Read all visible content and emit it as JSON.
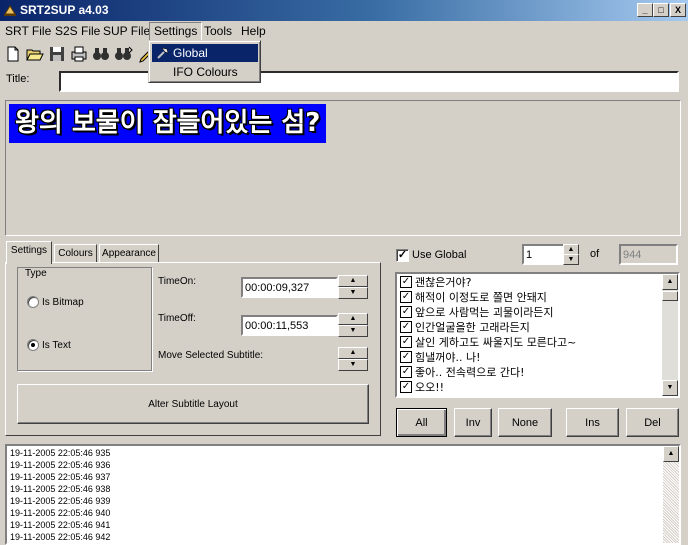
{
  "window": {
    "title": "SRT2SUP a4.03",
    "controls": [
      "_",
      "□",
      "X"
    ]
  },
  "menu": {
    "items": [
      "SRT File",
      "S2S File",
      "SUP File",
      "Settings",
      "Tools",
      "Help"
    ],
    "settings_dropdown": [
      "Global",
      "IFO Colours"
    ]
  },
  "toolbar": {
    "icons": [
      "new-file-icon",
      "open-folder-icon",
      "save-disk-icon",
      "print-icon",
      "find-binoculars-icon",
      "find-next-binoculars-icon",
      "pencil-icon"
    ]
  },
  "title_field": {
    "label": "Title:",
    "value": ""
  },
  "preview": {
    "text": "왕의 보물이 잠들어있는 섬?",
    "bg_color": "#0000ff"
  },
  "tabs": [
    "Settings",
    "Colours",
    "Appearance"
  ],
  "settings_panel": {
    "type_group_label": "Type",
    "radio_bitmap": "Is Bitmap",
    "radio_text": "Is Text",
    "selected_type": "Is Text",
    "time_on_label": "TimeOn:",
    "time_on_value": "00:00:09,327",
    "time_off_label": "TimeOff:",
    "time_off_value": "00:00:11,553",
    "move_label": "Move Selected Subtitle:",
    "alter_button": "Alter Subtitle Layout"
  },
  "right_panel": {
    "use_global_label": "Use Global",
    "use_global_checked": true,
    "current_index": "1",
    "of_label": "of",
    "total": "944",
    "subtitles": [
      "괜찮은거야?",
      "해적이 이정도로 쫄면 안돼지",
      "앞으로 사람먹는 괴물이라든지",
      "인간얼굴을한 고래라든지",
      "살인 게하고도 싸울지도 모른다고~",
      "힘낼꺼야.. 나!",
      "좋아.. 전속력으로 간다!",
      "오오!!"
    ],
    "buttons": [
      "All",
      "Inv",
      "None",
      "Ins",
      "Del"
    ]
  },
  "log": {
    "lines": [
      "19-11-2005 22:05:46 935",
      "19-11-2005 22:05:46 936",
      "19-11-2005 22:05:46 937",
      "19-11-2005 22:05:46 938",
      "19-11-2005 22:05:46 939",
      "19-11-2005 22:05:46 940",
      "19-11-2005 22:05:46 941",
      "19-11-2005 22:05:46 942"
    ]
  }
}
